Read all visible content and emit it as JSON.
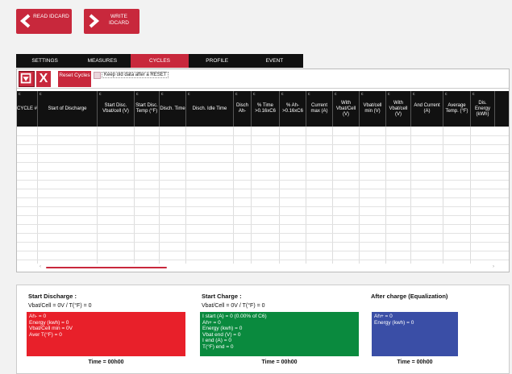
{
  "top_buttons": [
    {
      "name": "read-idcard-button",
      "icon": "chevron-left-icon",
      "label": "READ IDCARD"
    },
    {
      "name": "write-idcard-button",
      "icon": "chevron-right-icon",
      "label": "WRITE IDCARD"
    }
  ],
  "tabs": [
    {
      "label": "SETTINGS",
      "active": false
    },
    {
      "label": "MEASURES",
      "active": false
    },
    {
      "label": "CYCLES",
      "active": true
    },
    {
      "label": "PROFILE",
      "active": false
    },
    {
      "label": "EVENT",
      "active": false
    }
  ],
  "toolbar": {
    "download_icon": "download-icon",
    "delete_label": "X",
    "reset_label": "Reset Cycles",
    "keep_label": "Keep old data after a RESET",
    "keep_checked": false
  },
  "table": {
    "headers": [
      "CYCLE #",
      "Start of Discharge",
      "Start Disc. Vbat/cell (V)",
      "Start Disc. Temp (°F)",
      "Disch. Time",
      "Disch. Idle Time",
      "Disch Ah-",
      "% Time >0.16xC6",
      "% Ah- >0.16xC6",
      "Current max (A)",
      "With Vbat/Cell (V)",
      "Vbat/cell min (V)",
      "With Vbat/cell (V)",
      "And Current (A)",
      "Average Temp. (°F)",
      "Dis. Energy (kWh)"
    ],
    "rows": []
  },
  "bottom": {
    "start_discharge": {
      "title": "Start Discharge :",
      "subtitle": "Vbat/Cell = 0V / T(°F) = 0",
      "lines": [
        "Ah- = 0",
        "Energy (kwh) = 0",
        "Vbat/Cell min = 0V",
        "Aver T(°F) = 0"
      ],
      "time": "Time = 00h00",
      "color": "#e8202a"
    },
    "start_charge": {
      "title": "Start Charge :",
      "subtitle": "Vbat/Cell = 0V / T(°F) = 0",
      "lines": [
        "I start (A) = 0 (0.00% of C6)",
        "Ah+ = 0",
        "Energy (kwh) = 0",
        "Vbat end (V) = 0",
        "I end (A) = 0",
        "T(°F) end = 0"
      ],
      "time": "Time = 00h00",
      "color": "#0a8a3e"
    },
    "after_charge": {
      "title": "After charge (Equalization)",
      "lines": [
        "Ah+ = 0",
        "Energy (kwh) = 0"
      ],
      "time": "Time = 00h00",
      "color": "#3a4ea6"
    }
  }
}
